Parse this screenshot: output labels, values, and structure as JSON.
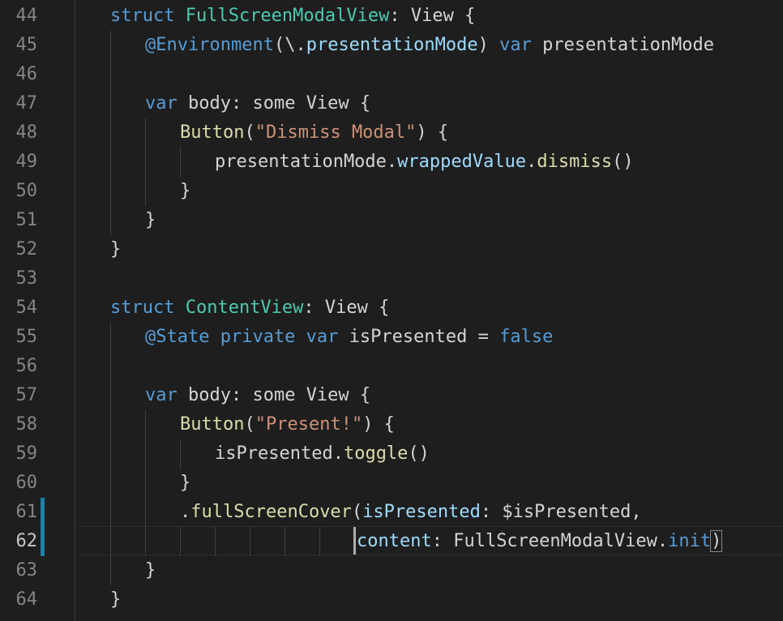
{
  "colors": {
    "background": "#1e1e1e",
    "keyword": "#569cd6",
    "type": "#4ec9b0",
    "string": "#ce9178",
    "function": "#dcdcaa",
    "property": "#9cdcfe",
    "plain": "#d4d4d4",
    "line_number": "#858585",
    "git_modified": "#1b81a8"
  },
  "active_line": 62,
  "modified_lines": [
    61,
    62
  ],
  "lines": [
    {
      "n": "44",
      "indent": 0,
      "tokens": [
        [
          "kw",
          "struct "
        ],
        [
          "ty",
          "FullScreenModalView"
        ],
        [
          "plain",
          ": View {"
        ]
      ]
    },
    {
      "n": "45",
      "indent": 1,
      "tokens": [
        [
          "kw",
          "@Environment"
        ],
        [
          "plain",
          "(\\."
        ],
        [
          "prop",
          "presentationMode"
        ],
        [
          "plain",
          ") "
        ],
        [
          "kw",
          "var"
        ],
        [
          "plain",
          " presentationMode"
        ]
      ]
    },
    {
      "n": "46",
      "indent": 1,
      "tokens": []
    },
    {
      "n": "47",
      "indent": 1,
      "tokens": [
        [
          "kw",
          "var"
        ],
        [
          "plain",
          " body: some View {"
        ]
      ]
    },
    {
      "n": "48",
      "indent": 2,
      "tokens": [
        [
          "fn",
          "Button"
        ],
        [
          "plain",
          "("
        ],
        [
          "str",
          "\"Dismiss Modal\""
        ],
        [
          "plain",
          ") {"
        ]
      ]
    },
    {
      "n": "49",
      "indent": 3,
      "tokens": [
        [
          "plain",
          "presentationMode."
        ],
        [
          "prop",
          "wrappedValue"
        ],
        [
          "plain",
          "."
        ],
        [
          "fn",
          "dismiss"
        ],
        [
          "plain",
          "()"
        ]
      ]
    },
    {
      "n": "50",
      "indent": 2,
      "tokens": [
        [
          "plain",
          "}"
        ]
      ]
    },
    {
      "n": "51",
      "indent": 1,
      "tokens": [
        [
          "plain",
          "}"
        ]
      ]
    },
    {
      "n": "52",
      "indent": 0,
      "tokens": [
        [
          "plain",
          "}"
        ]
      ]
    },
    {
      "n": "53",
      "indent": 0,
      "tokens": []
    },
    {
      "n": "54",
      "indent": 0,
      "tokens": [
        [
          "kw",
          "struct "
        ],
        [
          "ty",
          "ContentView"
        ],
        [
          "plain",
          ": View {"
        ]
      ]
    },
    {
      "n": "55",
      "indent": 1,
      "tokens": [
        [
          "kw",
          "@State private var"
        ],
        [
          "plain",
          " isPresented = "
        ],
        [
          "kw",
          "false"
        ]
      ]
    },
    {
      "n": "56",
      "indent": 1,
      "tokens": []
    },
    {
      "n": "57",
      "indent": 1,
      "tokens": [
        [
          "kw",
          "var"
        ],
        [
          "plain",
          " body: some View {"
        ]
      ]
    },
    {
      "n": "58",
      "indent": 2,
      "tokens": [
        [
          "fn",
          "Button"
        ],
        [
          "plain",
          "("
        ],
        [
          "str",
          "\"Present!\""
        ],
        [
          "plain",
          ") {"
        ]
      ]
    },
    {
      "n": "59",
      "indent": 3,
      "tokens": [
        [
          "plain",
          "isPresented."
        ],
        [
          "fn",
          "toggle"
        ],
        [
          "plain",
          "()"
        ]
      ]
    },
    {
      "n": "60",
      "indent": 2,
      "tokens": [
        [
          "plain",
          "}"
        ]
      ]
    },
    {
      "n": "61",
      "indent": 2,
      "tokens": [
        [
          "plain",
          "."
        ],
        [
          "fn",
          "fullScreenCover"
        ],
        [
          "plain",
          "("
        ],
        [
          "prop",
          "isPresented"
        ],
        [
          "plain",
          ": $isPresented,"
        ]
      ]
    },
    {
      "n": "62",
      "indent": 7,
      "tokens": [
        [
          "prop",
          "content"
        ],
        [
          "plain",
          ": FullScreenModalView."
        ],
        [
          "kw",
          "init"
        ],
        [
          "plain",
          ")"
        ]
      ]
    },
    {
      "n": "63",
      "indent": 1,
      "tokens": [
        [
          "plain",
          "}"
        ]
      ]
    },
    {
      "n": "64",
      "indent": 0,
      "tokens": [
        [
          "plain",
          "}"
        ]
      ]
    }
  ]
}
